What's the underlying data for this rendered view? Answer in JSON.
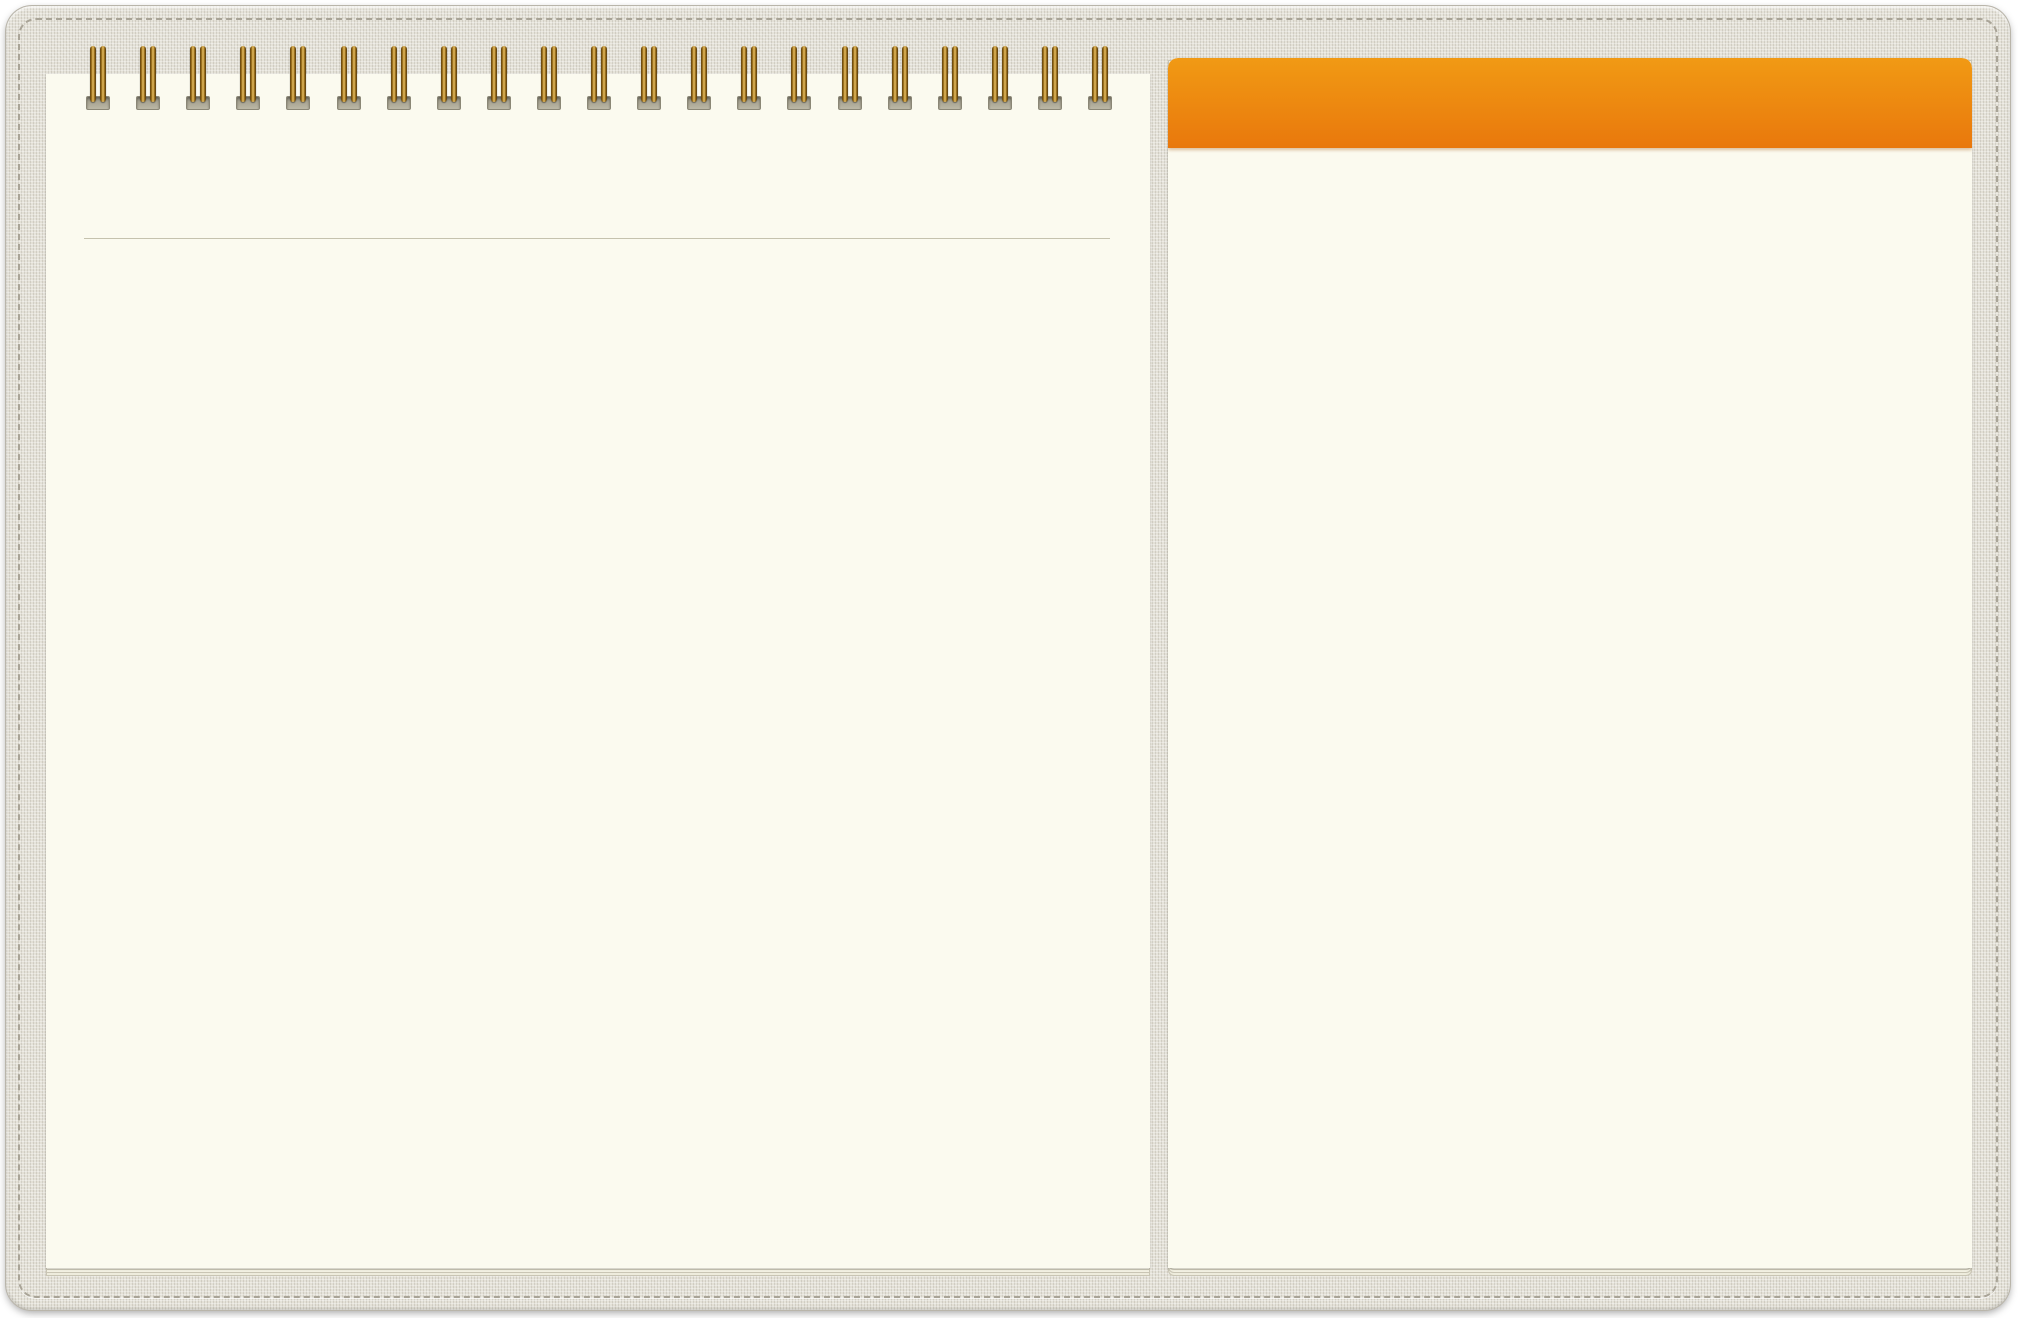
{
  "app": {
    "theme": "linen-notebook",
    "colors": {
      "cover": "#e3e0d6",
      "stitch": "#a9a497",
      "paper": "#fbfaef",
      "rule_line": "#c5c2ae",
      "header_orange_top": "#f19a14",
      "header_orange_bottom": "#e9780c",
      "ring_gold": "#a77a22"
    }
  },
  "left_notepad": {
    "binding": {
      "ring_count": 21,
      "icon": "spiral-ring-icon"
    },
    "header_text": "",
    "body_text": ""
  },
  "right_panel": {
    "header_title": "",
    "body_text": ""
  }
}
